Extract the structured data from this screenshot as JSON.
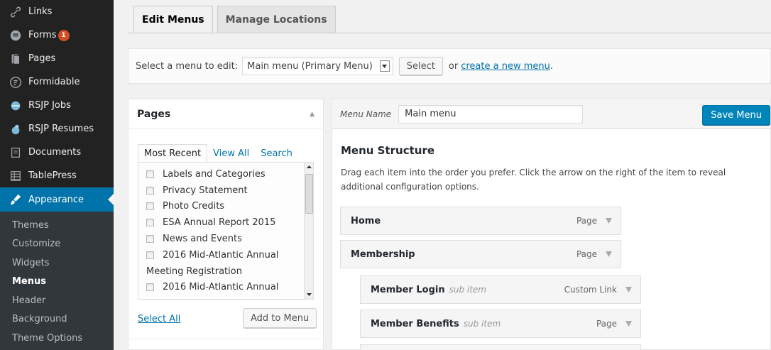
{
  "sidebar": {
    "items": [
      {
        "label": "Links",
        "icon": "link-icon"
      },
      {
        "label": "Forms",
        "icon": "forms-icon",
        "badge": "1"
      },
      {
        "label": "Pages",
        "icon": "pages-icon"
      },
      {
        "label": "Formidable",
        "icon": "formidable-icon"
      },
      {
        "label": "RSJP Jobs",
        "icon": "jobs-icon"
      },
      {
        "label": "RSJP Resumes",
        "icon": "resumes-icon"
      },
      {
        "label": "Documents",
        "icon": "documents-icon"
      },
      {
        "label": "TablePress",
        "icon": "tablepress-icon"
      }
    ],
    "current": {
      "label": "Appearance",
      "icon": "appearance-icon"
    },
    "submenu": [
      "Themes",
      "Customize",
      "Widgets",
      "Menus",
      "Header",
      "Background",
      "Theme Options"
    ]
  },
  "tabs": [
    "Edit Menus",
    "Manage Locations"
  ],
  "manage": {
    "label": "Select a menu to edit:",
    "selected": "Main menu (Primary Menu)",
    "select_button": "Select",
    "or_text": "or",
    "create_link": "create a new menu",
    "period": "."
  },
  "pages_panel": {
    "title": "Pages",
    "tabs": [
      "Most Recent",
      "View All",
      "Search"
    ],
    "items": [
      "Labels and Categories",
      "Privacy Statement",
      "Photo Credits",
      "ESA Annual Report 2015",
      "News and Events",
      "2016 Mid-Atlantic Annual"
    ],
    "wrapped_line": "Meeting Registration",
    "last_item": "2016 Mid-Atlantic Annual",
    "select_all": "Select All",
    "add_button": "Add to Menu"
  },
  "editor": {
    "menu_name_label": "Menu Name",
    "menu_name_value": "Main menu",
    "save_button": "Save Menu",
    "structure_title": "Menu Structure",
    "structure_desc": "Drag each item into the order you prefer. Click the arrow on the right of the item to reveal additional configuration options.",
    "items": [
      {
        "title": "Home",
        "sub": "",
        "type": "Page"
      },
      {
        "title": "Membership",
        "sub": "",
        "type": "Page"
      },
      {
        "title": "Member Login",
        "sub": "sub item",
        "type": "Custom Link"
      },
      {
        "title": "Member Benefits",
        "sub": "sub item",
        "type": "Page"
      }
    ]
  },
  "colors": {
    "sidebar_bg": "#222222",
    "current_bg": "#0073aa",
    "submenu_bg": "#32373c",
    "badge": "#d54e21",
    "primary_button": "#0085ba",
    "link": "#0073aa"
  }
}
